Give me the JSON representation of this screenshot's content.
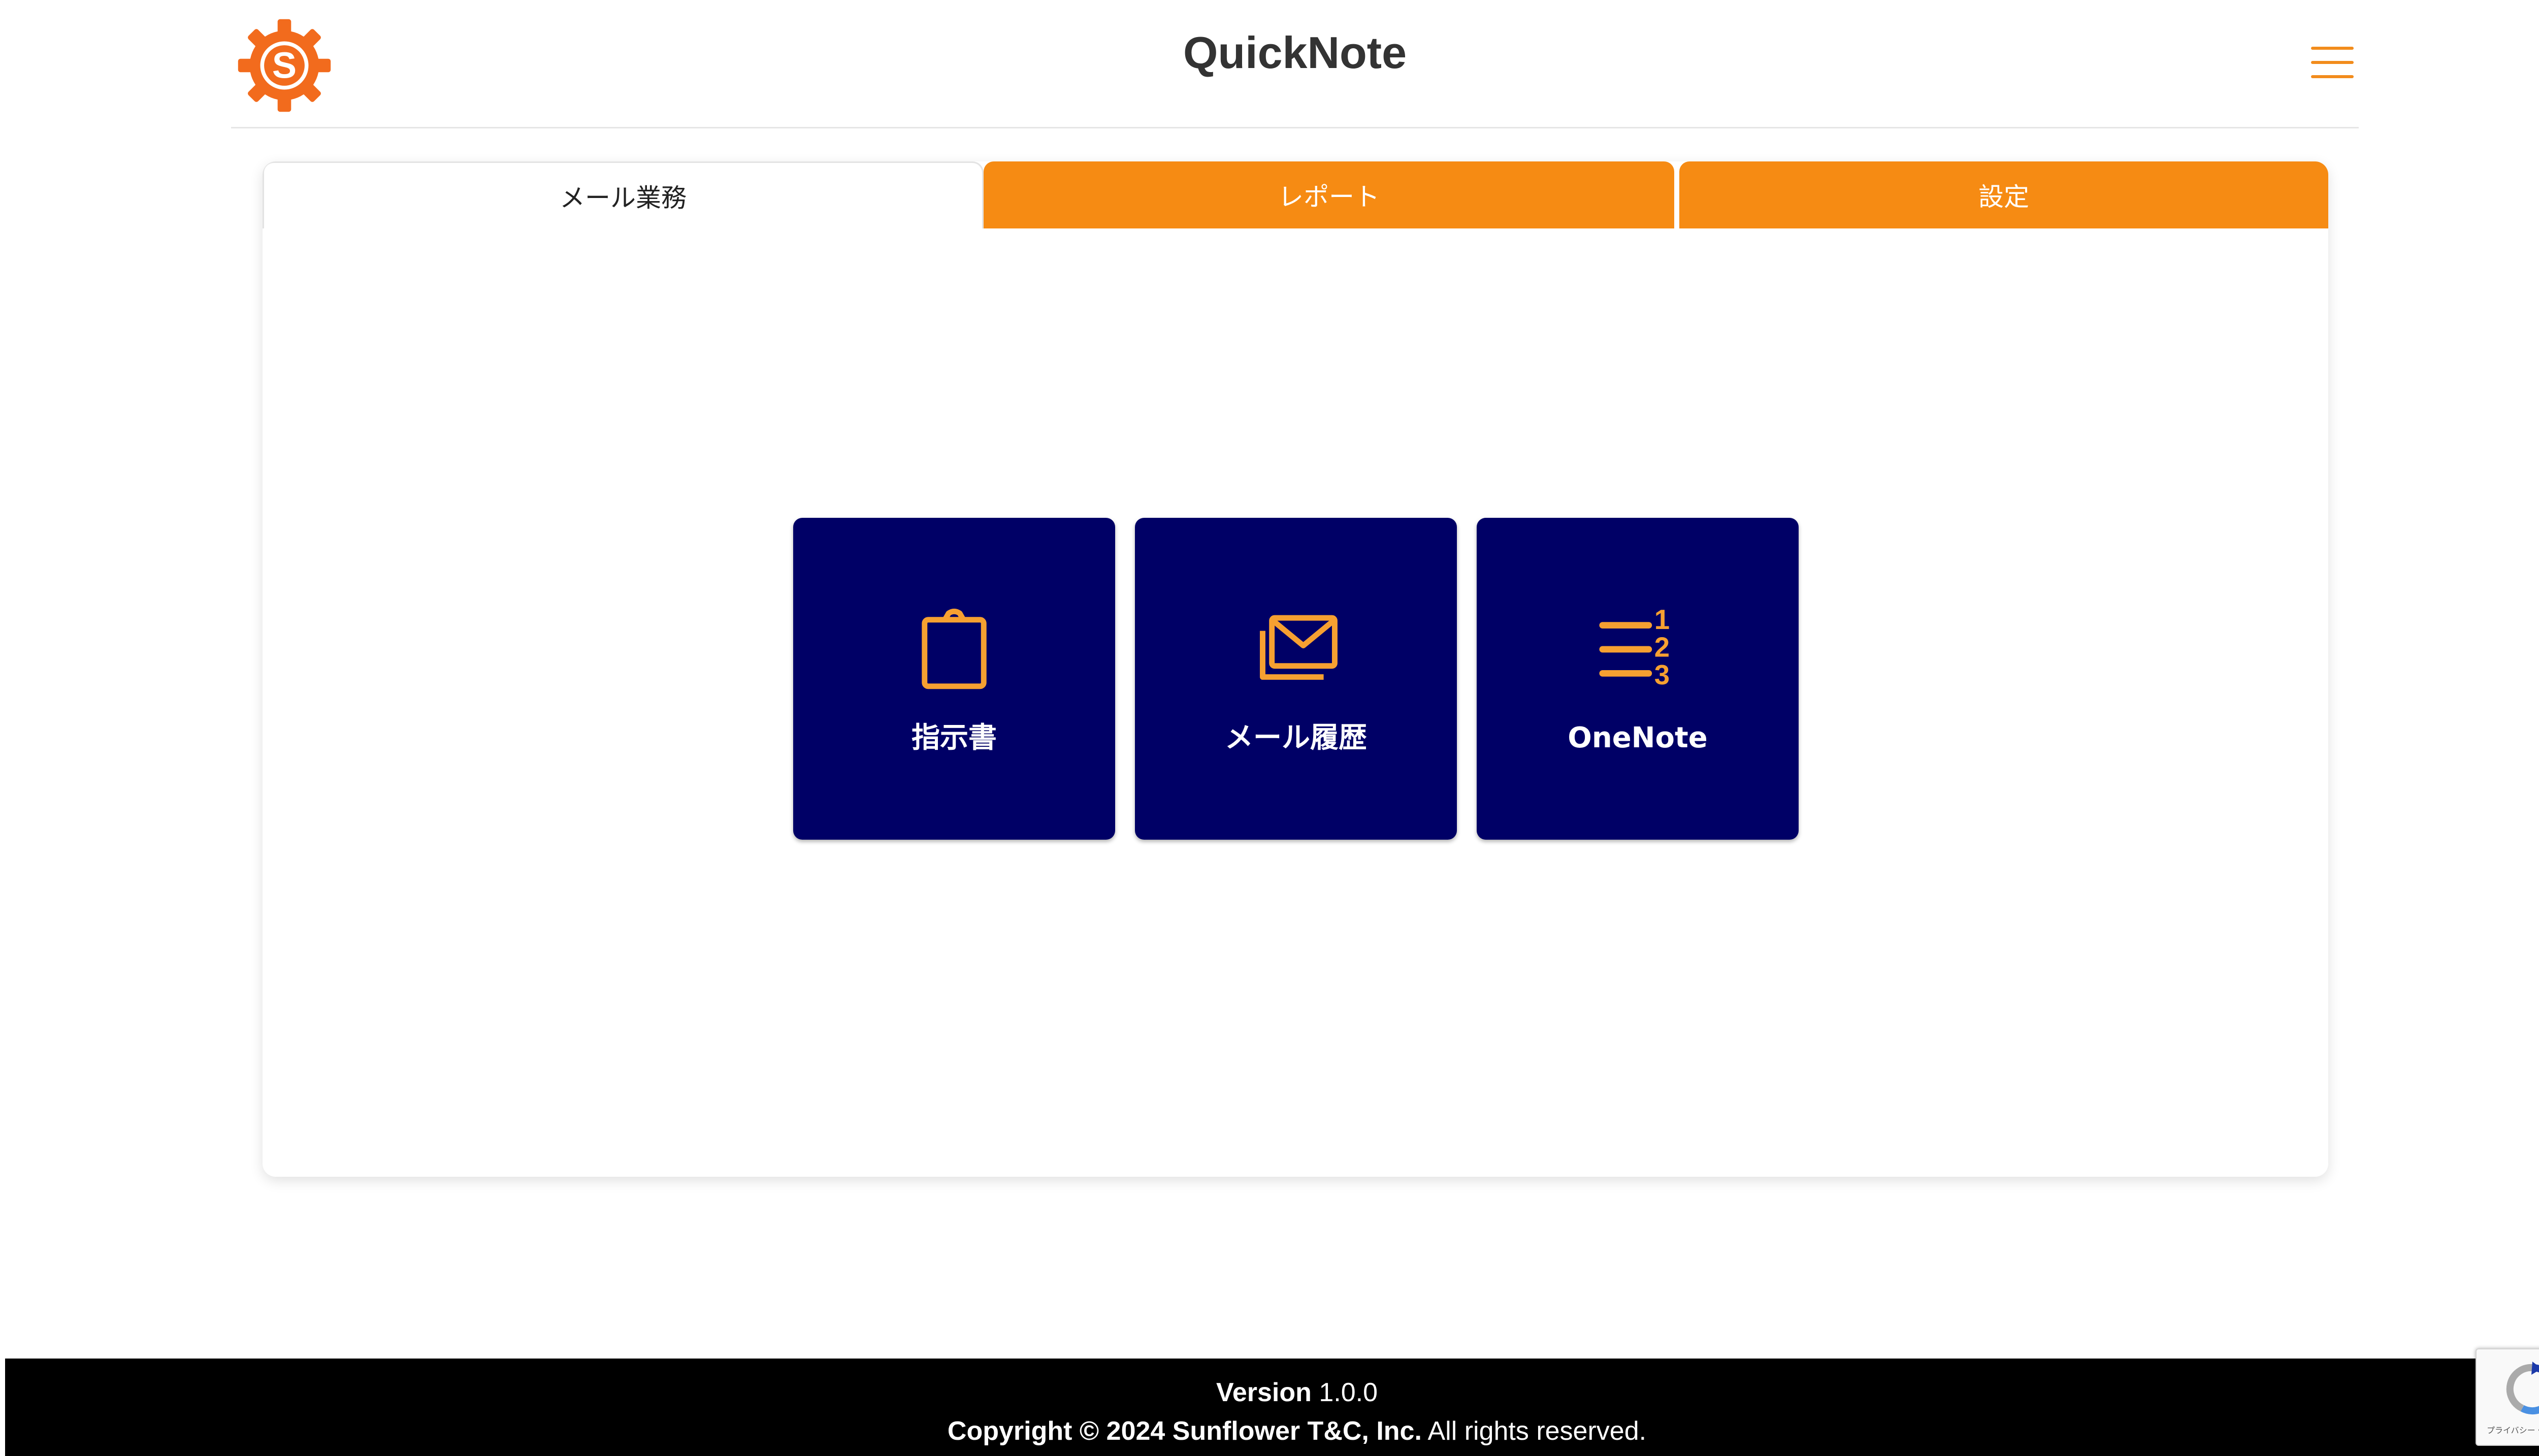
{
  "header": {
    "app_title": "QuickNote",
    "logo_letter": "S"
  },
  "tabs": [
    {
      "label": "メール業務",
      "active": true
    },
    {
      "label": "レポート",
      "active": false
    },
    {
      "label": "設定",
      "active": false
    }
  ],
  "tiles": [
    {
      "label": "指示書",
      "icon": "clipboard-icon"
    },
    {
      "label": "メール履歴",
      "icon": "mail-history-icon"
    },
    {
      "label": "OneNote",
      "icon": "numbered-list-icon"
    }
  ],
  "footer": {
    "version_label": "Version",
    "version_value": "1.0.0",
    "copyright_bold": "Copyright © 2024 Sunflower T&C, Inc.",
    "copyright_rest": "All rights reserved."
  },
  "recaptcha": {
    "text": "プライバシー・利用規約"
  },
  "colors": {
    "accent_orange": "#f68b13",
    "tile_navy": "#000066",
    "footer_black": "#000000"
  }
}
